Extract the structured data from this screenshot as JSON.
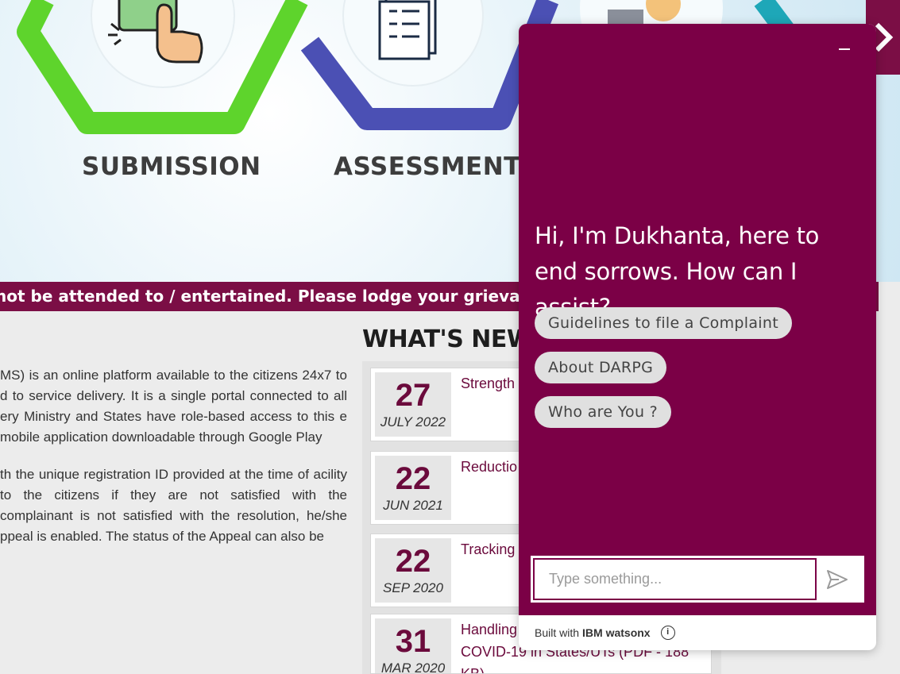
{
  "hero": {
    "steps": [
      "SUBMISSION",
      "ASSESSMENT"
    ]
  },
  "marquee": {
    "text": "not be attended to / entertained. Please lodge your grievance at the web"
  },
  "about": {
    "paragraph1": "MS) is an online platform available to the citizens 24x7 to d to service delivery. It is a single portal connected to all ery Ministry and States have role-based access to this e mobile application downloadable through Google Play",
    "paragraph2": "th the unique registration ID provided at the time of acility to the citizens if they are not satisfied with the complainant is not satisfied with the resolution, he/she ppeal is enabled. The status of the Appeal can also be"
  },
  "whats_new": {
    "title": "WHAT'S NEW",
    "items": [
      {
        "day": "27",
        "month": "JULY 2022",
        "text": "Strength Redressa (CPGRAM"
      },
      {
        "day": "22",
        "month": "JUN 2021",
        "text": "Reductio for dispo CPGRAM"
      },
      {
        "day": "22",
        "month": "SEP 2020",
        "text": "Tracking CPGRAM"
      },
      {
        "day": "31",
        "month": "MAR 2020",
        "text": "Handling received in CPGRAMS on COVID-19 in States/UTs (PDF - 188 KB)"
      }
    ]
  },
  "chat": {
    "greeting": "Hi, I'm Dukhanta, here to end sorrows. How can I assist?",
    "suggestions": [
      "Guidelines to file a Complaint",
      "About DARPG",
      "Who are You ?"
    ],
    "input_placeholder": "Type something...",
    "footer_prefix": "Built with",
    "footer_brand": "IBM watsonx",
    "accent": "#7b0046"
  },
  "colors": {
    "brand": "#7b0e45",
    "hex_green": "#55cc33",
    "hex_blue": "#4a4fb0"
  }
}
